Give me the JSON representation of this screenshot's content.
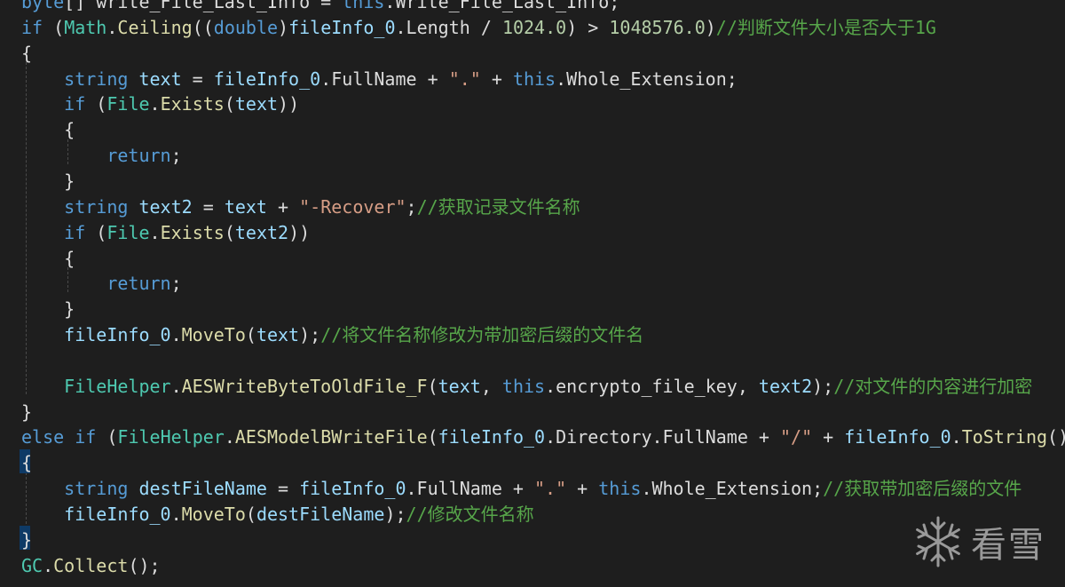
{
  "editor": {
    "lines": [
      [
        {
          "t": "byte",
          "c": "kw"
        },
        {
          "t": "[] write_File_Last_Info = ",
          "c": "pl"
        },
        {
          "t": "this",
          "c": "kw"
        },
        {
          "t": ".Write_File_Last_Info;",
          "c": "pl"
        }
      ],
      [
        {
          "t": "if",
          "c": "kw"
        },
        {
          "t": " (",
          "c": "pl"
        },
        {
          "t": "Math",
          "c": "ty"
        },
        {
          "t": ".",
          "c": "pl"
        },
        {
          "t": "Ceiling",
          "c": "fn"
        },
        {
          "t": "((",
          "c": "pl"
        },
        {
          "t": "double",
          "c": "kw"
        },
        {
          "t": ")",
          "c": "pl"
        },
        {
          "t": "fileInfo_0",
          "c": "id"
        },
        {
          "t": ".Length / ",
          "c": "pl"
        },
        {
          "t": "1024.0",
          "c": "nm"
        },
        {
          "t": ") > ",
          "c": "pl"
        },
        {
          "t": "1048576.0",
          "c": "nm"
        },
        {
          "t": ")",
          "c": "pl"
        },
        {
          "t": "//判断文件大小是否大于1G",
          "c": "cm"
        }
      ],
      [
        {
          "t": "{",
          "c": "pl"
        }
      ],
      [
        {
          "t": "    ",
          "c": "pl"
        },
        {
          "t": "string",
          "c": "kw"
        },
        {
          "t": " ",
          "c": "pl"
        },
        {
          "t": "text",
          "c": "id"
        },
        {
          "t": " = ",
          "c": "pl"
        },
        {
          "t": "fileInfo_0",
          "c": "id"
        },
        {
          "t": ".FullName + ",
          "c": "pl"
        },
        {
          "t": "\".\"",
          "c": "st"
        },
        {
          "t": " + ",
          "c": "pl"
        },
        {
          "t": "this",
          "c": "kw"
        },
        {
          "t": ".Whole_Extension;",
          "c": "pl"
        }
      ],
      [
        {
          "t": "    ",
          "c": "pl"
        },
        {
          "t": "if",
          "c": "kw"
        },
        {
          "t": " (",
          "c": "pl"
        },
        {
          "t": "File",
          "c": "ty"
        },
        {
          "t": ".",
          "c": "pl"
        },
        {
          "t": "Exists",
          "c": "fn"
        },
        {
          "t": "(",
          "c": "pl"
        },
        {
          "t": "text",
          "c": "id"
        },
        {
          "t": "))",
          "c": "pl"
        }
      ],
      [
        {
          "t": "    {",
          "c": "pl"
        }
      ],
      [
        {
          "t": "        ",
          "c": "pl"
        },
        {
          "t": "return",
          "c": "kw"
        },
        {
          "t": ";",
          "c": "pl"
        }
      ],
      [
        {
          "t": "    }",
          "c": "pl"
        }
      ],
      [
        {
          "t": "    ",
          "c": "pl"
        },
        {
          "t": "string",
          "c": "kw"
        },
        {
          "t": " ",
          "c": "pl"
        },
        {
          "t": "text2",
          "c": "id"
        },
        {
          "t": " = ",
          "c": "pl"
        },
        {
          "t": "text",
          "c": "id"
        },
        {
          "t": " + ",
          "c": "pl"
        },
        {
          "t": "\"-Recover\"",
          "c": "st"
        },
        {
          "t": ";",
          "c": "pl"
        },
        {
          "t": "//获取记录文件名称",
          "c": "cm"
        }
      ],
      [
        {
          "t": "    ",
          "c": "pl"
        },
        {
          "t": "if",
          "c": "kw"
        },
        {
          "t": " (",
          "c": "pl"
        },
        {
          "t": "File",
          "c": "ty"
        },
        {
          "t": ".",
          "c": "pl"
        },
        {
          "t": "Exists",
          "c": "fn"
        },
        {
          "t": "(",
          "c": "pl"
        },
        {
          "t": "text2",
          "c": "id"
        },
        {
          "t": "))",
          "c": "pl"
        }
      ],
      [
        {
          "t": "    {",
          "c": "pl"
        }
      ],
      [
        {
          "t": "        ",
          "c": "pl"
        },
        {
          "t": "return",
          "c": "kw"
        },
        {
          "t": ";",
          "c": "pl"
        }
      ],
      [
        {
          "t": "    }",
          "c": "pl"
        }
      ],
      [
        {
          "t": "    ",
          "c": "pl"
        },
        {
          "t": "fileInfo_0",
          "c": "id"
        },
        {
          "t": ".",
          "c": "pl"
        },
        {
          "t": "MoveTo",
          "c": "fn"
        },
        {
          "t": "(",
          "c": "pl"
        },
        {
          "t": "text",
          "c": "id"
        },
        {
          "t": ");",
          "c": "pl"
        },
        {
          "t": "//将文件名称修改为带加密后缀的文件名",
          "c": "cm"
        }
      ],
      [],
      [
        {
          "t": "    ",
          "c": "pl"
        },
        {
          "t": "FileHelper",
          "c": "ty"
        },
        {
          "t": ".",
          "c": "pl"
        },
        {
          "t": "AESWriteByteToOldFile_F",
          "c": "fn"
        },
        {
          "t": "(",
          "c": "pl"
        },
        {
          "t": "text",
          "c": "id"
        },
        {
          "t": ", ",
          "c": "pl"
        },
        {
          "t": "this",
          "c": "kw"
        },
        {
          "t": ".encrypto_file_key, ",
          "c": "pl"
        },
        {
          "t": "text2",
          "c": "id"
        },
        {
          "t": ");",
          "c": "pl"
        },
        {
          "t": "//对文件的内容进行加密",
          "c": "cm"
        }
      ],
      [
        {
          "t": "}",
          "c": "pl"
        }
      ],
      [
        {
          "t": "else",
          "c": "kw"
        },
        {
          "t": " ",
          "c": "pl"
        },
        {
          "t": "if",
          "c": "kw"
        },
        {
          "t": " (",
          "c": "pl"
        },
        {
          "t": "FileHelper",
          "c": "ty"
        },
        {
          "t": ".",
          "c": "pl"
        },
        {
          "t": "AESModelBWriteFile",
          "c": "fn"
        },
        {
          "t": "(",
          "c": "pl"
        },
        {
          "t": "fileInfo_0",
          "c": "id"
        },
        {
          "t": ".Directory.FullName + ",
          "c": "pl"
        },
        {
          "t": "\"/\"",
          "c": "st"
        },
        {
          "t": " + ",
          "c": "pl"
        },
        {
          "t": "fileInfo_0",
          "c": "id"
        },
        {
          "t": ".",
          "c": "pl"
        },
        {
          "t": "ToString",
          "c": "fn"
        },
        {
          "t": "(),",
          "c": "pl"
        }
      ],
      [
        {
          "t": "{",
          "c": "pl"
        }
      ],
      [
        {
          "t": "    ",
          "c": "pl"
        },
        {
          "t": "string",
          "c": "kw"
        },
        {
          "t": " ",
          "c": "pl"
        },
        {
          "t": "destFileName",
          "c": "id"
        },
        {
          "t": " = ",
          "c": "pl"
        },
        {
          "t": "fileInfo_0",
          "c": "id"
        },
        {
          "t": ".FullName + ",
          "c": "pl"
        },
        {
          "t": "\".\"",
          "c": "st"
        },
        {
          "t": " + ",
          "c": "pl"
        },
        {
          "t": "this",
          "c": "kw"
        },
        {
          "t": ".Whole_Extension;",
          "c": "pl"
        },
        {
          "t": "//获取带加密后缀的文件",
          "c": "cm"
        }
      ],
      [
        {
          "t": "    ",
          "c": "pl"
        },
        {
          "t": "fileInfo_0",
          "c": "id"
        },
        {
          "t": ".",
          "c": "pl"
        },
        {
          "t": "MoveTo",
          "c": "fn"
        },
        {
          "t": "(",
          "c": "pl"
        },
        {
          "t": "destFileName",
          "c": "id"
        },
        {
          "t": ");",
          "c": "pl"
        },
        {
          "t": "//修改文件名称",
          "c": "cm"
        }
      ],
      [
        {
          "t": "}",
          "c": "pl"
        }
      ],
      [
        {
          "t": "GC",
          "c": "ty"
        },
        {
          "t": ".",
          "c": "pl"
        },
        {
          "t": "Collect",
          "c": "fn"
        },
        {
          "t": "();",
          "c": "pl"
        }
      ]
    ],
    "highlighted_brace_lines": [
      18,
      21
    ]
  },
  "watermark": {
    "text": "看雪",
    "icon": "snowflake-icon"
  }
}
